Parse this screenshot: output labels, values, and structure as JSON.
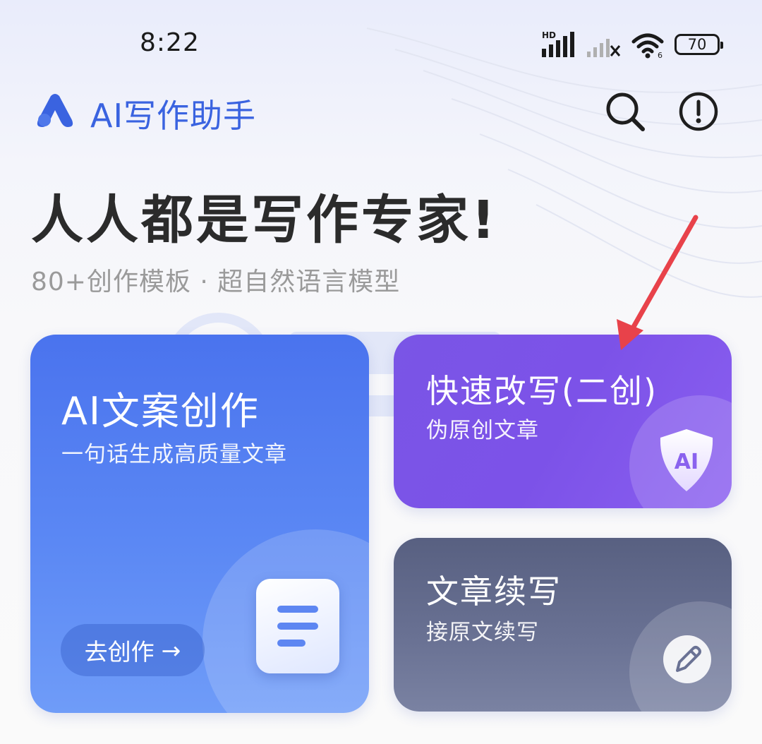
{
  "status_bar": {
    "time": "8:22",
    "network_label": "HD",
    "battery": "70"
  },
  "header": {
    "title": "AI写作助手",
    "logo_icon": "app-logo-icon",
    "search_icon": "search-icon",
    "info_icon": "info-icon"
  },
  "hero": {
    "title": "人人都是写作专家!",
    "subtitle": "80+创作模板 · 超自然语言模型"
  },
  "cards": {
    "ai_copy": {
      "title": "AI文案创作",
      "desc": "一句话生成高质量文章",
      "cta": "去创作",
      "cta_arrow": "→",
      "color_top": "#4a73ee",
      "color_bottom": "#6f9cf8"
    },
    "rewrite": {
      "title": "快速改写(二创)",
      "desc": "伪原创文章",
      "badge": "AI",
      "color": "#7a55e6"
    },
    "continue": {
      "title": "文章续写",
      "desc": "接原文续写",
      "color": "#586081"
    }
  },
  "colors": {
    "brand": "#3a63e0",
    "annotation_arrow": "#e8424a"
  }
}
